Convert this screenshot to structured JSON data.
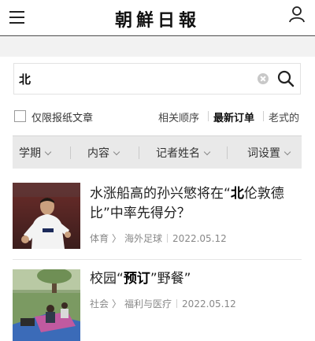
{
  "header": {
    "logo_text": "朝鮮日報",
    "menu_icon": "hamburger-menu-icon",
    "user_icon": "user-account-icon"
  },
  "search": {
    "query": "北",
    "clear_icon": "clear-icon",
    "search_icon": "search-icon"
  },
  "filters": {
    "paper_only_label": "仅限报纸文章",
    "paper_only_checked": false,
    "sort_options": [
      "相关顺序",
      "最新订单",
      "老式的"
    ],
    "sort_selected": "最新订单"
  },
  "facets": [
    "学期",
    "内容",
    "记者姓名",
    "词设置"
  ],
  "articles": [
    {
      "headline_pre": "水涨船高的孙兴慜将在“",
      "headline_hl": "北",
      "headline_post": "伦敦德比”中率先得分？",
      "category": "体育",
      "subcategory": "海外足球",
      "date": "2022.05.12",
      "thumb_desc": "soccer-player-photo"
    },
    {
      "headline_pre": "校园“",
      "headline_hl": "预订",
      "headline_post": "”野餐”",
      "category": "社会",
      "subcategory": "福利与医疗",
      "date": "2022.05.12",
      "thumb_desc": "picnic-photo"
    }
  ],
  "colors": {
    "accent_text": "#111111",
    "meta_text": "#888888",
    "facet_bg": "#e9e9e9"
  }
}
